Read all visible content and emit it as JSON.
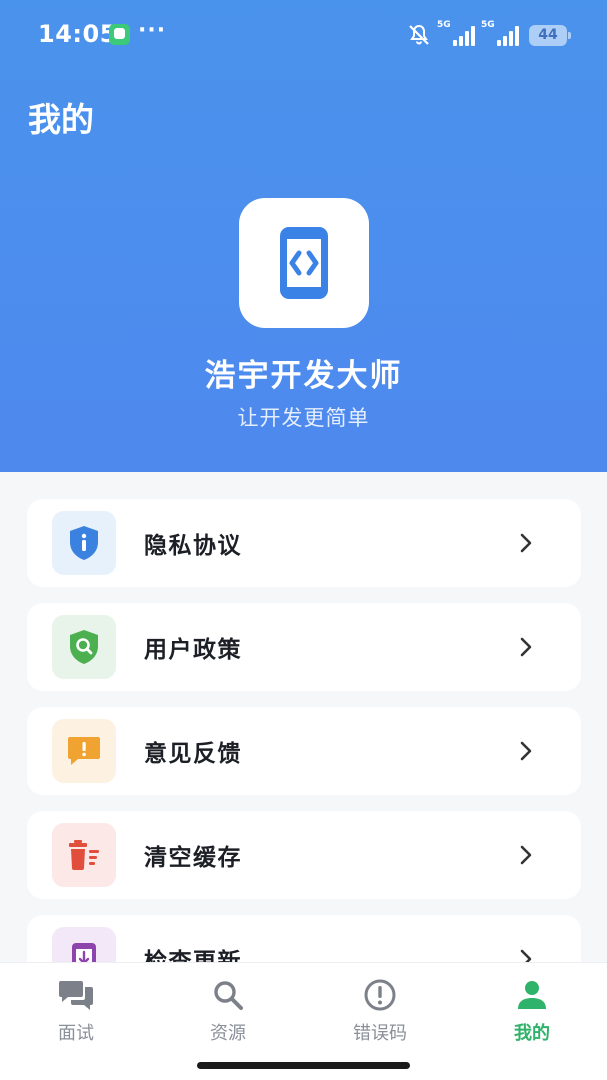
{
  "status_bar": {
    "time": "14:05",
    "more": "···",
    "net1": "5G",
    "net2": "5G",
    "battery": "44"
  },
  "header": {
    "title": "我的",
    "app_name": "浩宇开发大师",
    "slogan": "让开发更简单"
  },
  "menu": {
    "items": [
      {
        "label": "隐私协议",
        "icon": "shield-info-icon",
        "color": "#3b82e0",
        "bg": "#e7f1fc"
      },
      {
        "label": "用户政策",
        "icon": "shield-search-icon",
        "color": "#4caf50",
        "bg": "#e8f4ea"
      },
      {
        "label": "意见反馈",
        "icon": "feedback-icon",
        "color": "#f0a330",
        "bg": "#fdf2e2"
      },
      {
        "label": "清空缓存",
        "icon": "trash-clear-icon",
        "color": "#e14e3c",
        "bg": "#fce8e6"
      },
      {
        "label": "检查更新",
        "icon": "update-icon",
        "color": "#8e44ad",
        "bg": "#f3e8f8"
      }
    ]
  },
  "tabbar": {
    "tabs": [
      {
        "label": "面试",
        "icon": "chat-icon",
        "active": false
      },
      {
        "label": "资源",
        "icon": "search-icon",
        "active": false
      },
      {
        "label": "错误码",
        "icon": "alert-icon",
        "active": false
      },
      {
        "label": "我的",
        "icon": "person-icon",
        "active": true
      }
    ],
    "active_color": "#2fb36a",
    "inactive_color": "#8a8f99"
  },
  "colors": {
    "header_bg": "#4a93ec",
    "page_bg": "#f6f7f9"
  }
}
